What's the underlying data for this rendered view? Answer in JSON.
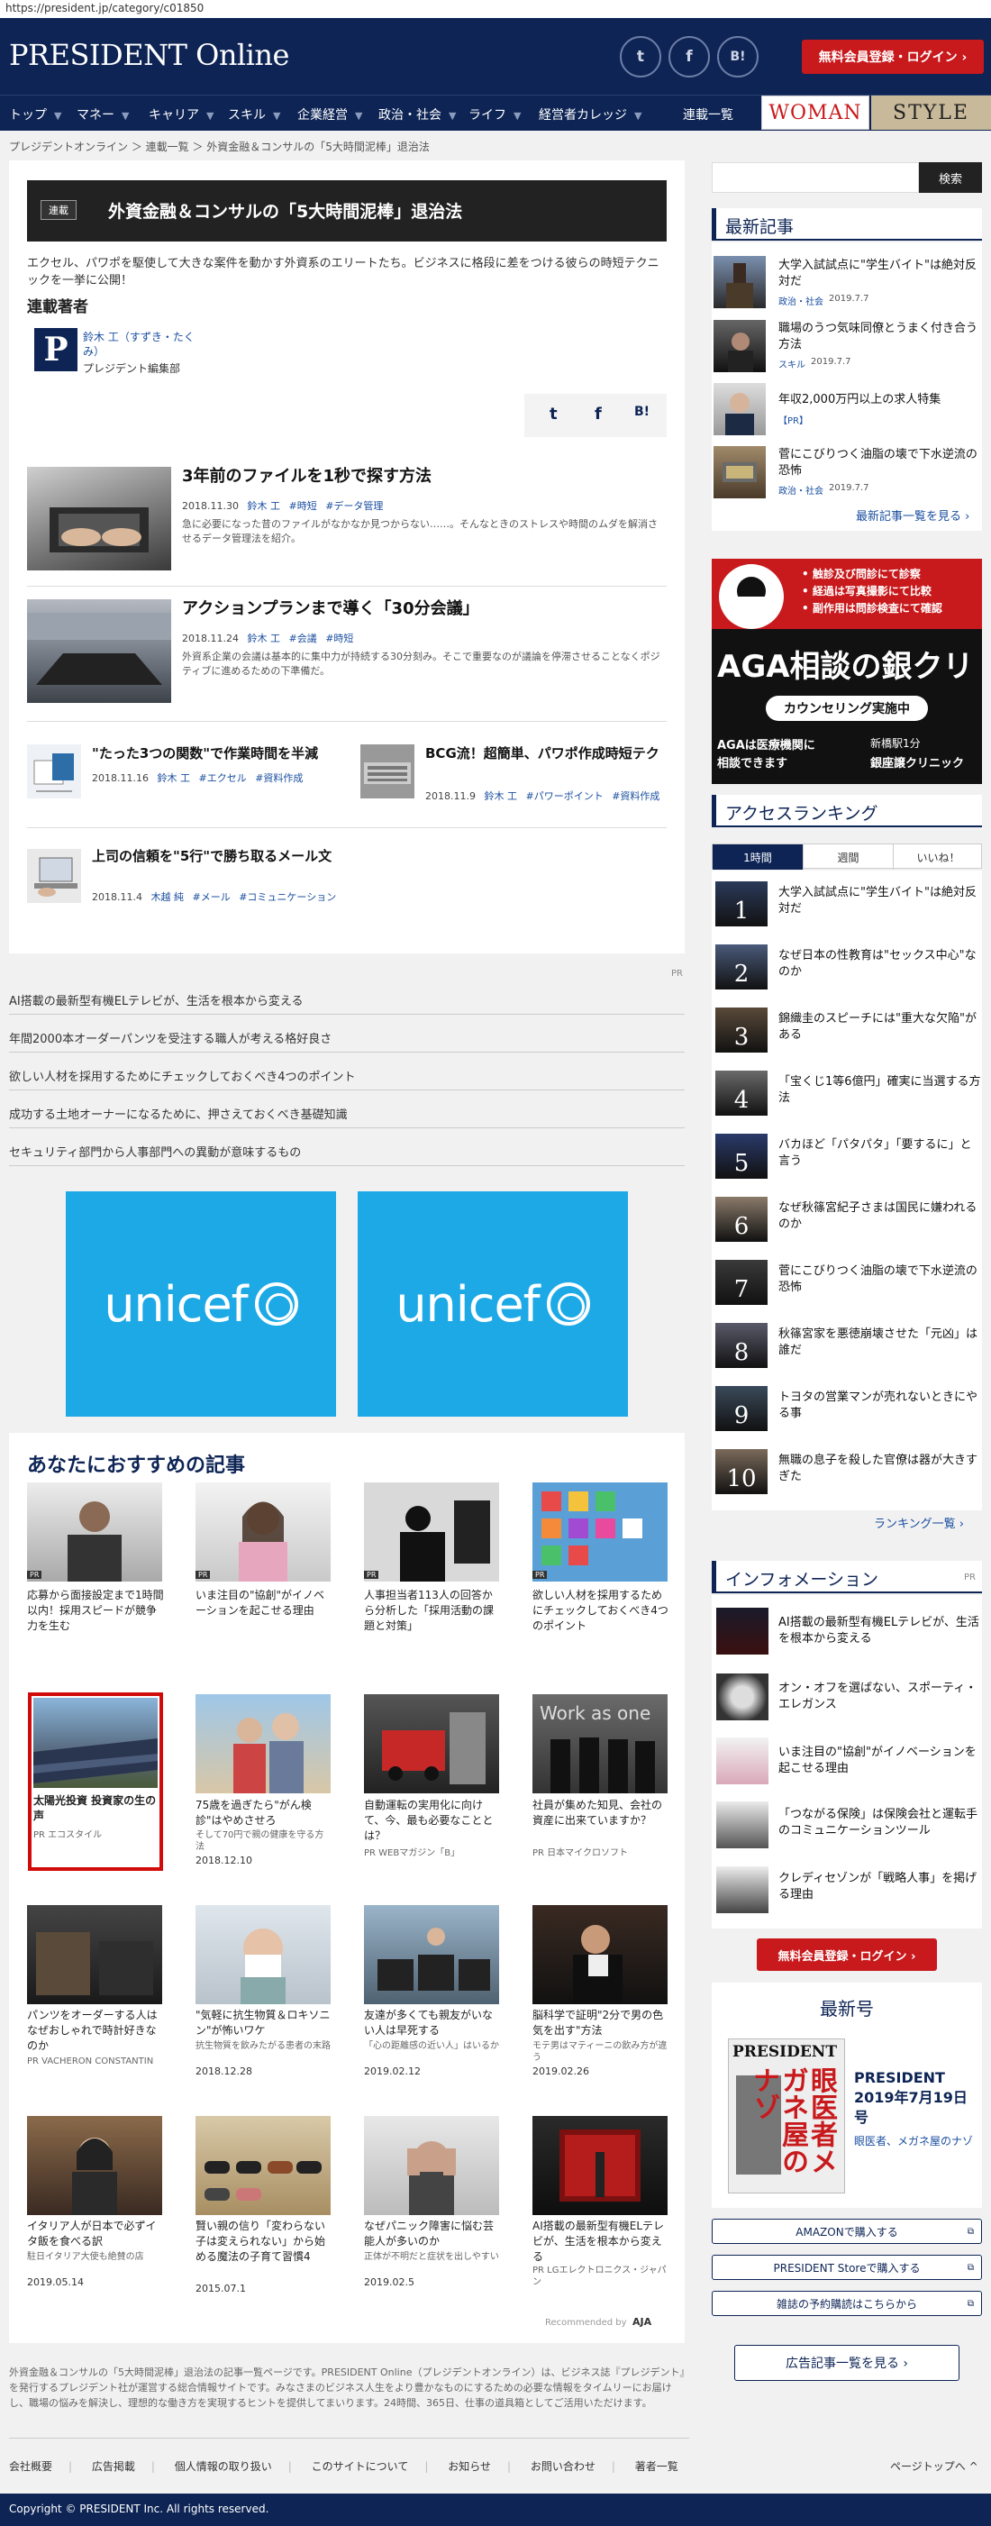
{
  "browser": {
    "url": "https://president.jp/category/c01850"
  },
  "header": {
    "logo": "PRESIDENT Online",
    "social": [
      "t",
      "f",
      "B!"
    ],
    "login": "無料会員登録・ログイン ›"
  },
  "nav": {
    "items": [
      "トップ",
      "マネー",
      "キャリア",
      "スキル",
      "企業経営",
      "政治・社会",
      "ライフ",
      "経営者カレッジ",
      "連載一覧"
    ],
    "woman": "WOMAN",
    "style": "STYLE"
  },
  "breadcrumb": "プレジデントオンライン ＞ 連載一覧 ＞ 外資金融＆コンサルの「5大時間泥棒」退治法",
  "series": {
    "tag": "連載",
    "title": "外資金融＆コンサルの「5大時間泥棒」退治法",
    "description": "エクセル、パワポを駆使して大きな案件を動かす外資系のエリートたち。ビジネスに格段に差をつける彼らの時短テクニックを一挙に公開！",
    "author_heading": "連載著者",
    "author_name": "鈴木 工（すずき・たくみ）",
    "author_org": "プレジデント編集部",
    "share": [
      "t",
      "f",
      "B!"
    ]
  },
  "articles": [
    {
      "title": "3年前のファイルを1秒で探す方法",
      "date": "2018.11.30",
      "author": "鈴木 工",
      "tags": [
        "#時短",
        "#データ管理"
      ],
      "desc": "急に必要になった昔のファイルがなかなか見つからない……。そんなときのストレスや時間のムダを解消させるデータ管理法を紹介。"
    },
    {
      "title": "アクションプランまで導く「30分会議」",
      "date": "2018.11.24",
      "author": "鈴木 工",
      "tags": [
        "#会議",
        "#時短"
      ],
      "desc": "外資系企業の会議は基本的に集中力が持続する30分刻み。そこで重要なのが議論を停滞させることなくポジティブに進めるための下準備だ。"
    }
  ],
  "small_articles": [
    {
      "title": "\"たった3つの関数\"で作業時間を半減",
      "date": "2018.11.16",
      "author": "鈴木 工",
      "tags": [
        "#エクセル",
        "#資料作成"
      ]
    },
    {
      "title": "BCG流！超簡単、パワポ作成時短テク",
      "date": "2018.11.9",
      "author": "鈴木 工",
      "tags": [
        "#パワーポイント",
        "#資料作成"
      ]
    },
    {
      "title": "上司の信頼を\"5行\"で勝ち取るメール文",
      "date": "2018.11.4",
      "author": "木越 純",
      "tags": [
        "#メール",
        "#コミュニケーション"
      ]
    }
  ],
  "pr_mark": "PR",
  "pr_links": [
    "AI搭載の最新型有機ELテレビが、生活を根本から変える",
    "年間2000本オーダーパンツを受注する職人が考える格好良さ",
    "欲しい人材を採用するためにチェックしておくべき4つのポイント",
    "成功する土地オーナーになるために、押さえておくべき基礎知識",
    "セキュリティ部門から人事部門への異動が意味するもの"
  ],
  "unicef": "unicef",
  "recommend": {
    "heading": "あなたにおすすめの記事",
    "row1": [
      {
        "text": "応募から面接設定まで1時間以内！採用スピードが競争力を生む"
      },
      {
        "text": "いま注目の\"協創\"がイノベーションを起こせる理由"
      },
      {
        "text": "人事担当者113人の回答から分析した「採用活動の課題と対策」"
      },
      {
        "text": "欲しい人材を採用するためにチェックしておくべき4つのポイント"
      }
    ],
    "row2": [
      {
        "text": "太陽光投資 投資家の生の声",
        "sub": "PR エコスタイル"
      },
      {
        "text": "75歳を過ぎたら\"がん検診\"はやめさせろ",
        "sub": "そして70円で親の健康を守る方法",
        "date": "2018.12.10"
      },
      {
        "text": "自動運転の実用化に向けて、今、最も必要なこととは？",
        "sub": "PR WEBマガジン「B」"
      },
      {
        "text": "社員が集めた知見、会社の資産に出来ていますか？",
        "sub": "PR 日本マイクロソフト"
      }
    ],
    "row3": [
      {
        "text": "パンツをオーダーする人はなぜおしゃれで時計好きなのか",
        "sub": "PR VACHERON CONSTANTIN"
      },
      {
        "text": "\"気軽に抗生物質＆ロキソニン\"が怖いワケ",
        "sub": "抗生物質を飲みたがる患者の末路",
        "date": "2018.12.28"
      },
      {
        "text": "友達が多くても親友がいない人は早死する",
        "sub": "「心の距離感の近い人」はいるか",
        "date": "2019.02.12"
      },
      {
        "text": "脳科学で証明\"2分で男の色気を出す\"方法",
        "sub": "モテ男はマティーニの飲み方が違う",
        "date": "2019.02.26"
      }
    ],
    "row4": [
      {
        "text": "イタリア人が日本で必ずイタ飯を食べる訳",
        "sub": "駐日イタリア大使も絶賛の店",
        "date": "2019.05.14"
      },
      {
        "text": "賢い親の信り「変わらない子は変えられない」から始める魔法の子育て習慣4",
        "date": "2015.07.1"
      },
      {
        "text": "なぜパニック障害に悩む芸能人が多いのか",
        "sub": "正体が不明だと症状を出しやすい",
        "date": "2019.02.5"
      },
      {
        "text": "AI搭載の最新型有機ELテレビが、生活を根本から変える",
        "sub": "PR LGエレクトロニクス・ジャパン"
      }
    ],
    "pr": "PR",
    "recommended_by": "Recommended by",
    "aja": "AJA"
  },
  "footer": {
    "text": "外資金融＆コンサルの「5大時間泥棒」退治法の記事一覧ページです。PRESIDENT Online（プレジデントオンライン）は、ビジネス誌『プレジデント』を発行するプレジデント社が運営する総合情報サイトです。みなさまのビジネス人生をより豊かなものにするための必要な情報をタイムリーにお届けし、職場の悩みを解決し、理想的な働き方を実現するヒントを提供してまいります。24時間、365日、仕事の道具箱としてご活用いただけます。",
    "links": [
      "会社概要",
      "広告掲載",
      "個人情報の取り扱い",
      "このサイトについて",
      "お知らせ",
      "お問い合わせ",
      "著者一覧"
    ],
    "pagetop": "ページトップへ",
    "copyright": "Copyright © PRESIDENT Inc. All rights reserved."
  },
  "sidebar": {
    "search_button": "検索",
    "latest_heading": "最新記事",
    "latest": [
      {
        "title": "大学入試試点に\"学生バイト\"は絶対反対だ",
        "cat": "政治・社会",
        "date": "2019.7.7"
      },
      {
        "title": "職場のうつ気味同僚とうまく付き合う方法",
        "cat": "スキル",
        "date": "2019.7.7"
      },
      {
        "title": "年収2,000万円以上の求人特集",
        "cat": "【PR】",
        "date": ""
      },
      {
        "title": "菅にこびりつく油脂の壊で下水逆流の恐怖",
        "cat": "政治・社会",
        "date": "2019.7.7"
      }
    ],
    "latest_more": "最新記事一覧を見る ›",
    "aga": {
      "bullets": [
        "• 触診及び問診にて診察",
        "• 経過は写真撮影にて比較",
        "• 副作用は問診検査にて確認"
      ],
      "big": "AGA相談の銀クリ",
      "pill": "カウンセリング実施中",
      "foot1": "AGAは医療機関に",
      "foot2": "相談できます",
      "station": "新橋駅1分",
      "clinic": "銀座譲クリニック"
    },
    "ranking_heading": "アクセスランキング",
    "ranking_tabs": [
      "1時間",
      "週間",
      "いいね！"
    ],
    "ranking": [
      "大学入試試点に\"学生バイト\"は絶対反対だ",
      "なぜ日本の性教育は\"セックス中心\"なのか",
      "錦織圭のスピーチには\"重大な欠陥\"がある",
      "「宝くじ1等6億円」確実に当選する方法",
      "バカほど「パタパタ」「要するに」と言う",
      "なぜ秋篠宮紀子さまは国民に嫌われるのか",
      "菅にこびりつく油脂の壊で下水逆流の恐怖",
      "秋篠宮家を悪徳崩壊させた「元凶」は誰だ",
      "トヨタの営業マンが売れないときにやる事",
      "無職の息子を殺した官僚は器が大きすぎた"
    ],
    "ranking_more": "ランキング一覧 ›",
    "info_heading": "インフォメーション",
    "info_pr": "PR",
    "info": [
      "AI搭載の最新型有機ELテレビが、生活を根本から変える",
      "オン・オフを選ばない、スポーティ・エレガンス",
      "いま注目の\"協創\"がイノベーションを起こせる理由",
      "「つながる保険」は保険会社と運転手のコミュニケーションツール",
      "クレディセゾンが「戦略人事」を掲げる理由"
    ],
    "login": "無料会員登録・ログイン ›",
    "issue_heading": "最新号",
    "issue_title": "PRESIDENT 2019年7月19日号",
    "issue_sub": "眼医者、メガネ屋のナゾ",
    "issue_cover_logo": "PRESIDENT",
    "issue_cover_text": "眼医者メガネ屋のナゾ",
    "buy": [
      "AMAZONで購入する",
      "PRESIDENT Storeで購入する",
      "雑誌の予約購読はこちらから"
    ],
    "ad_list": "広告記事一覧を見る ›"
  }
}
